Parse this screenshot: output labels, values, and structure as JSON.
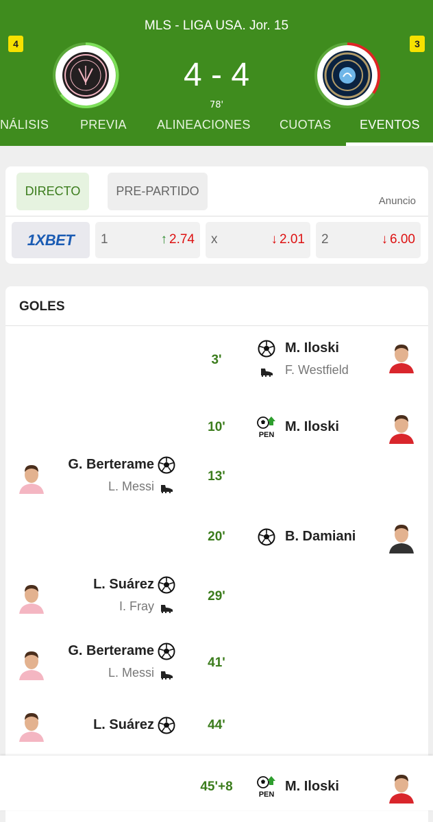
{
  "header": {
    "league": "MLS - LIGA USA.  Jor. 15",
    "home_red_cards": "4",
    "away_red_cards": "3",
    "score": "4 - 4",
    "minute": "78'",
    "home_logo_icon": "inter-miami-crest-icon",
    "away_logo_icon": "philadelphia-union-crest-icon"
  },
  "tabs": [
    {
      "label": "NÁLISIS"
    },
    {
      "label": "PREVIA"
    },
    {
      "label": "ALINEACIONES"
    },
    {
      "label": "CUOTAS"
    },
    {
      "label": "EVENTOS",
      "active": true
    }
  ],
  "odds": {
    "live_label": "DIRECTO",
    "prematch_label": "PRE-PARTIDO",
    "ad_label": "Anuncio",
    "bookmaker": "1XBET",
    "items": [
      {
        "label": "1",
        "value": "2.74",
        "trend": "up"
      },
      {
        "label": "x",
        "value": "2.01",
        "trend": "down"
      },
      {
        "label": "2",
        "value": "6.00",
        "trend": "down"
      }
    ]
  },
  "goals": {
    "title": "GOLES",
    "events": [
      {
        "minute": "3'",
        "side": "away",
        "scorer": "M. Iloski",
        "assist": "F. Westfield",
        "type": "goal"
      },
      {
        "minute": "10'",
        "side": "away",
        "scorer": "M. Iloski",
        "assist": "",
        "type": "penalty"
      },
      {
        "minute": "13'",
        "side": "home",
        "scorer": "G. Berterame",
        "assist": "L. Messi",
        "type": "goal"
      },
      {
        "minute": "20'",
        "side": "away",
        "scorer": "B. Damiani",
        "assist": "",
        "type": "goal"
      },
      {
        "minute": "29'",
        "side": "home",
        "scorer": "L. Suárez",
        "assist": "I. Fray",
        "type": "goal"
      },
      {
        "minute": "41'",
        "side": "home",
        "scorer": "G. Berterame",
        "assist": "L. Messi",
        "type": "goal"
      },
      {
        "minute": "44'",
        "side": "home",
        "scorer": "L. Suárez",
        "assist": "",
        "type": "goal"
      },
      {
        "minute": "45'+8",
        "side": "away",
        "scorer": "M. Iloski",
        "assist": "",
        "type": "penalty"
      }
    ],
    "pen_label": "PEN"
  },
  "colors": {
    "header_green": "#3f8c1e",
    "minute_green": "#3b7c1c",
    "odds_red": "#dd1111",
    "odds_green": "#2e8b2e",
    "bookie_blue": "#1a5bb3",
    "card_yellow": "#f6e100"
  }
}
